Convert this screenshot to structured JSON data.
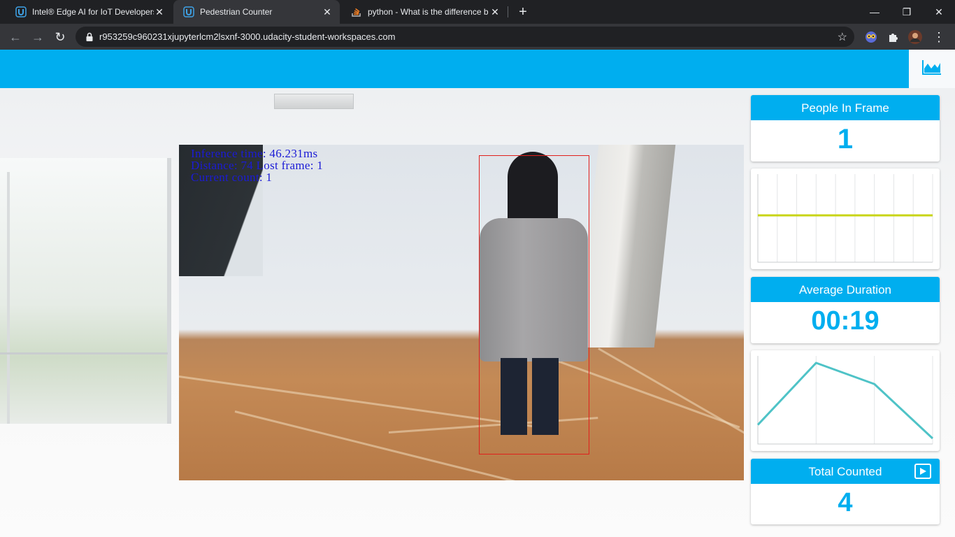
{
  "browser": {
    "tabs": [
      {
        "title": "Intel® Edge AI for IoT Developers",
        "close": "✕",
        "favicon": "udacity-icon"
      },
      {
        "title": "Pedestrian Counter",
        "close": "✕",
        "favicon": "udacity-icon"
      },
      {
        "title": "python - What is the difference b",
        "close": "✕",
        "favicon": "stackoverflow-icon"
      }
    ],
    "new_tab": "+",
    "window_controls": {
      "minimize": "—",
      "restore": "❐",
      "close": "✕"
    },
    "url": "r953259c960231xjupyterlcm2lsxnf-3000.udacity-student-workspaces.com",
    "nav": {
      "back": "←",
      "forward": "→",
      "reload": "↻"
    },
    "star": "☆",
    "menu": "⋮"
  },
  "app": {
    "header_color": "#00aeef",
    "stats_icon": "area-chart-icon"
  },
  "video": {
    "overlay": {
      "line1": "Inference time: 46.231ms",
      "line2": "Distance: 74 Lost frame: 1",
      "line3": "Current count: 1"
    }
  },
  "panel": {
    "people_in_frame": {
      "label": "People In Frame",
      "value": "1"
    },
    "average_duration": {
      "label": "Average Duration",
      "value": "00:19"
    },
    "total_counted": {
      "label": "Total Counted",
      "value": "4",
      "icon": "play-icon"
    }
  },
  "chart_data": [
    {
      "type": "line",
      "series": [
        {
          "values": [
            1,
            1
          ]
        }
      ],
      "color": "#c8d416",
      "grid": true
    },
    {
      "type": "line",
      "series": [
        {
          "values": [
            0.18,
            1.0,
            0.72,
            0.0
          ]
        }
      ],
      "color": "#4fc3c7",
      "grid": true
    }
  ]
}
